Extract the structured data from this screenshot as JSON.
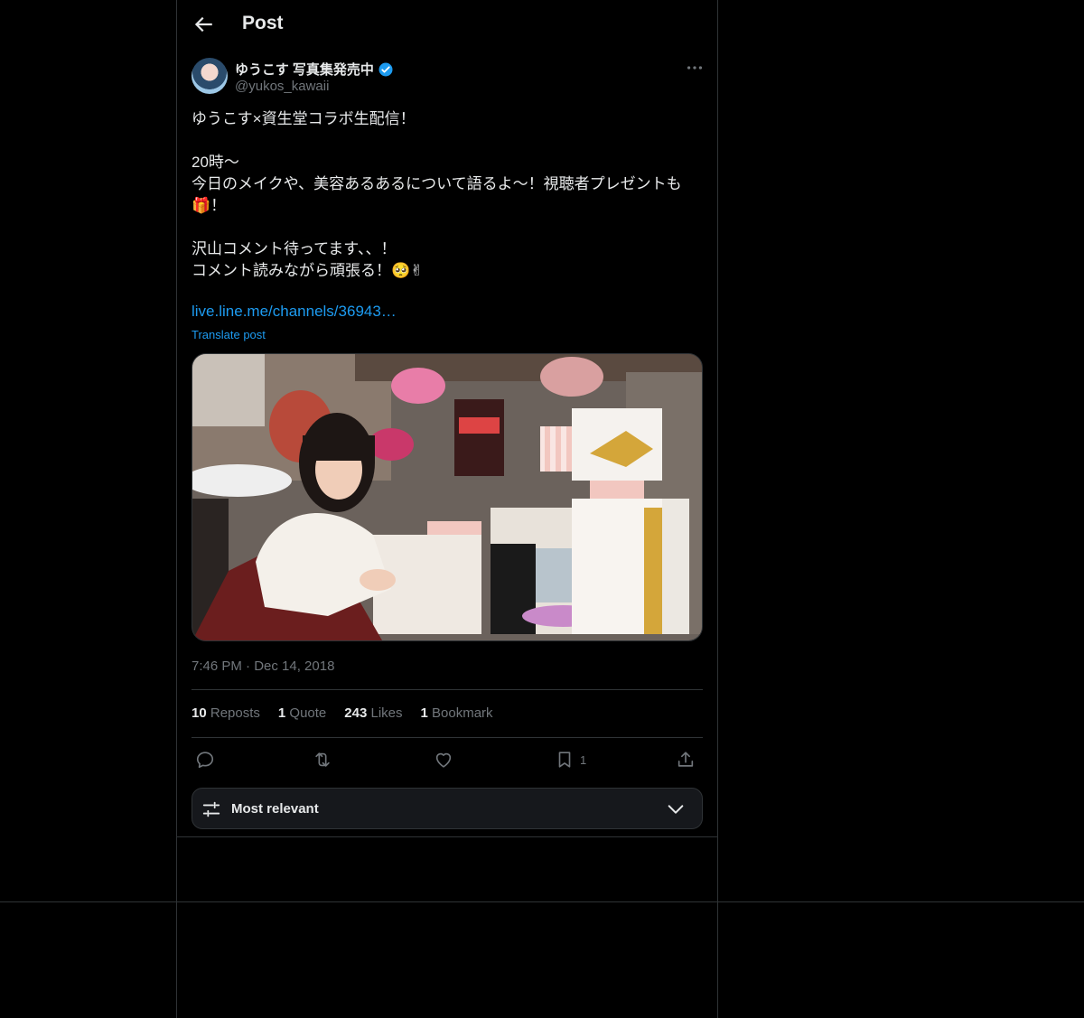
{
  "header": {
    "title": "Post"
  },
  "author": {
    "display_name": "ゆうこす 写真集発売中",
    "handle": "@yukos_kawaii",
    "verified": true
  },
  "post": {
    "text": "ゆうこす×資生堂コラボ生配信！\n\n20時〜\n今日のメイクや、美容あるあるについて語るよ〜！視聴者プレゼントも🎁！\n\n沢山コメント待ってます、、！\nコメント読みながら頑張る！🥺✌",
    "link": "live.line.me/channels/36943…",
    "translate_label": "Translate post",
    "timestamp": "7:46 PM · Dec 14, 2018"
  },
  "stats": {
    "reposts_count": "10",
    "reposts_label": "Reposts",
    "quote_count": "1",
    "quote_label": "Quote",
    "likes_count": "243",
    "likes_label": "Likes",
    "bookmark_count": "1",
    "bookmark_label": "Bookmark"
  },
  "actions": {
    "bookmark_count": "1"
  },
  "sort": {
    "label": "Most relevant"
  },
  "colors": {
    "accent": "#1d9bf0",
    "muted": "#71767b",
    "border": "#2f3336",
    "background": "#000000"
  },
  "icons": [
    "back-arrow-icon",
    "verified-badge-icon",
    "more-icon",
    "reply-icon",
    "repost-icon",
    "like-icon",
    "bookmark-icon",
    "share-icon",
    "sliders-icon",
    "chevron-down-icon"
  ]
}
